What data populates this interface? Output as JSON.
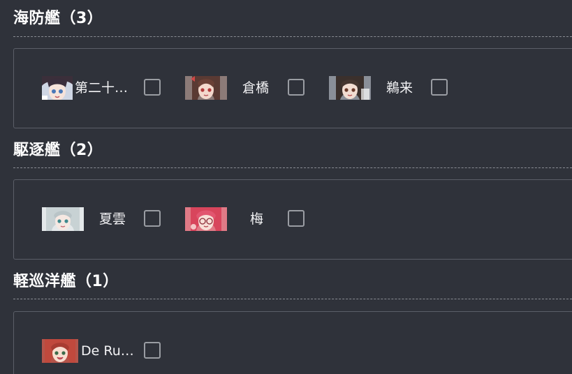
{
  "sections": [
    {
      "title": "海防艦（3）",
      "ships": [
        {
          "name": "第二十…",
          "portrait": "escort-ship-portrait-icon",
          "checked": false
        },
        {
          "name": "倉橋",
          "portrait": "escort-ship-portrait-icon",
          "checked": false
        },
        {
          "name": "鵜来",
          "portrait": "escort-ship-portrait-icon",
          "checked": false
        }
      ]
    },
    {
      "title": "駆逐艦（2）",
      "ships": [
        {
          "name": "夏雲",
          "portrait": "destroyer-portrait-icon",
          "checked": false
        },
        {
          "name": "梅",
          "portrait": "destroyer-portrait-icon",
          "checked": false
        }
      ]
    },
    {
      "title": "軽巡洋艦（1）",
      "ships": [
        {
          "name": "De Ru…",
          "portrait": "light-cruiser-portrait-icon",
          "checked": false
        }
      ]
    }
  ]
}
